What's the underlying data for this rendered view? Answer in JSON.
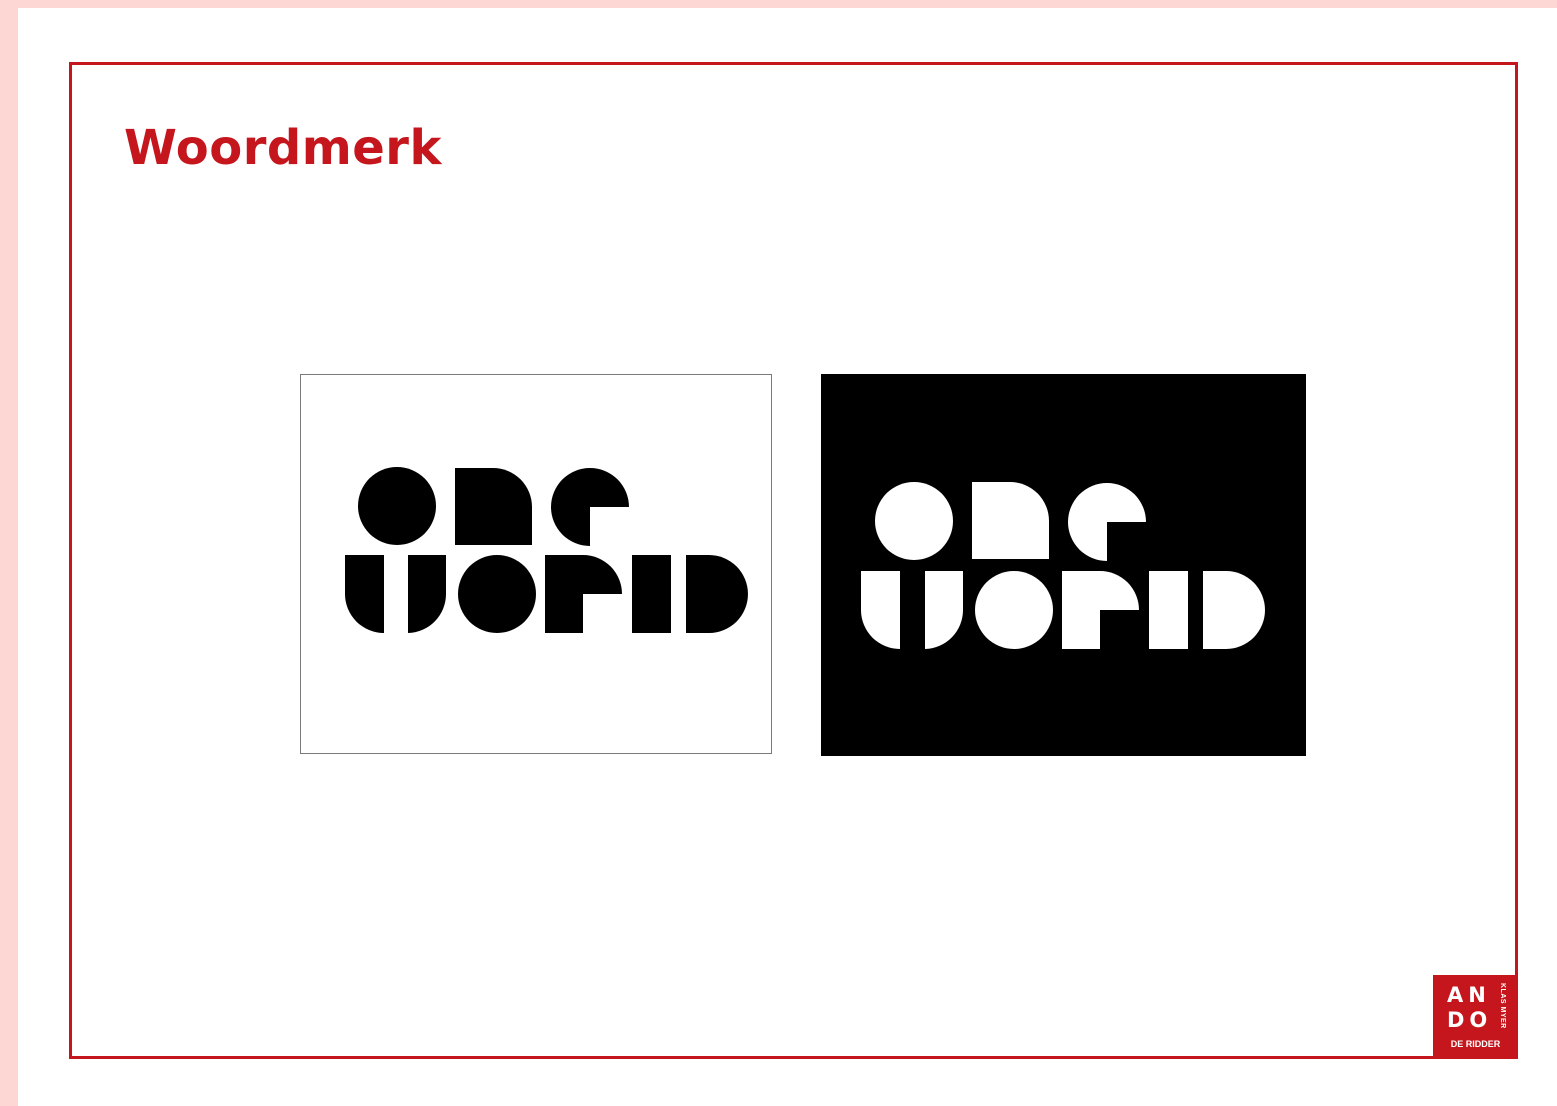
{
  "page": {
    "title": "Woordmerk"
  },
  "colors": {
    "accent": "#c4161c",
    "page_background": "#fdd7d3",
    "slide_background": "#ffffff"
  },
  "logos": [
    {
      "variant": "black-on-white",
      "foreground": "#000000",
      "background": "#ffffff",
      "wordmark": "ONE WORLD"
    },
    {
      "variant": "white-on-black",
      "foreground": "#ffffff",
      "background": "#000000",
      "wordmark": "ONE WORLD"
    }
  ],
  "badge": {
    "line1": "AN",
    "line2": "DO",
    "side": "KLAS MYER",
    "bottom": "DE RIDDER"
  }
}
